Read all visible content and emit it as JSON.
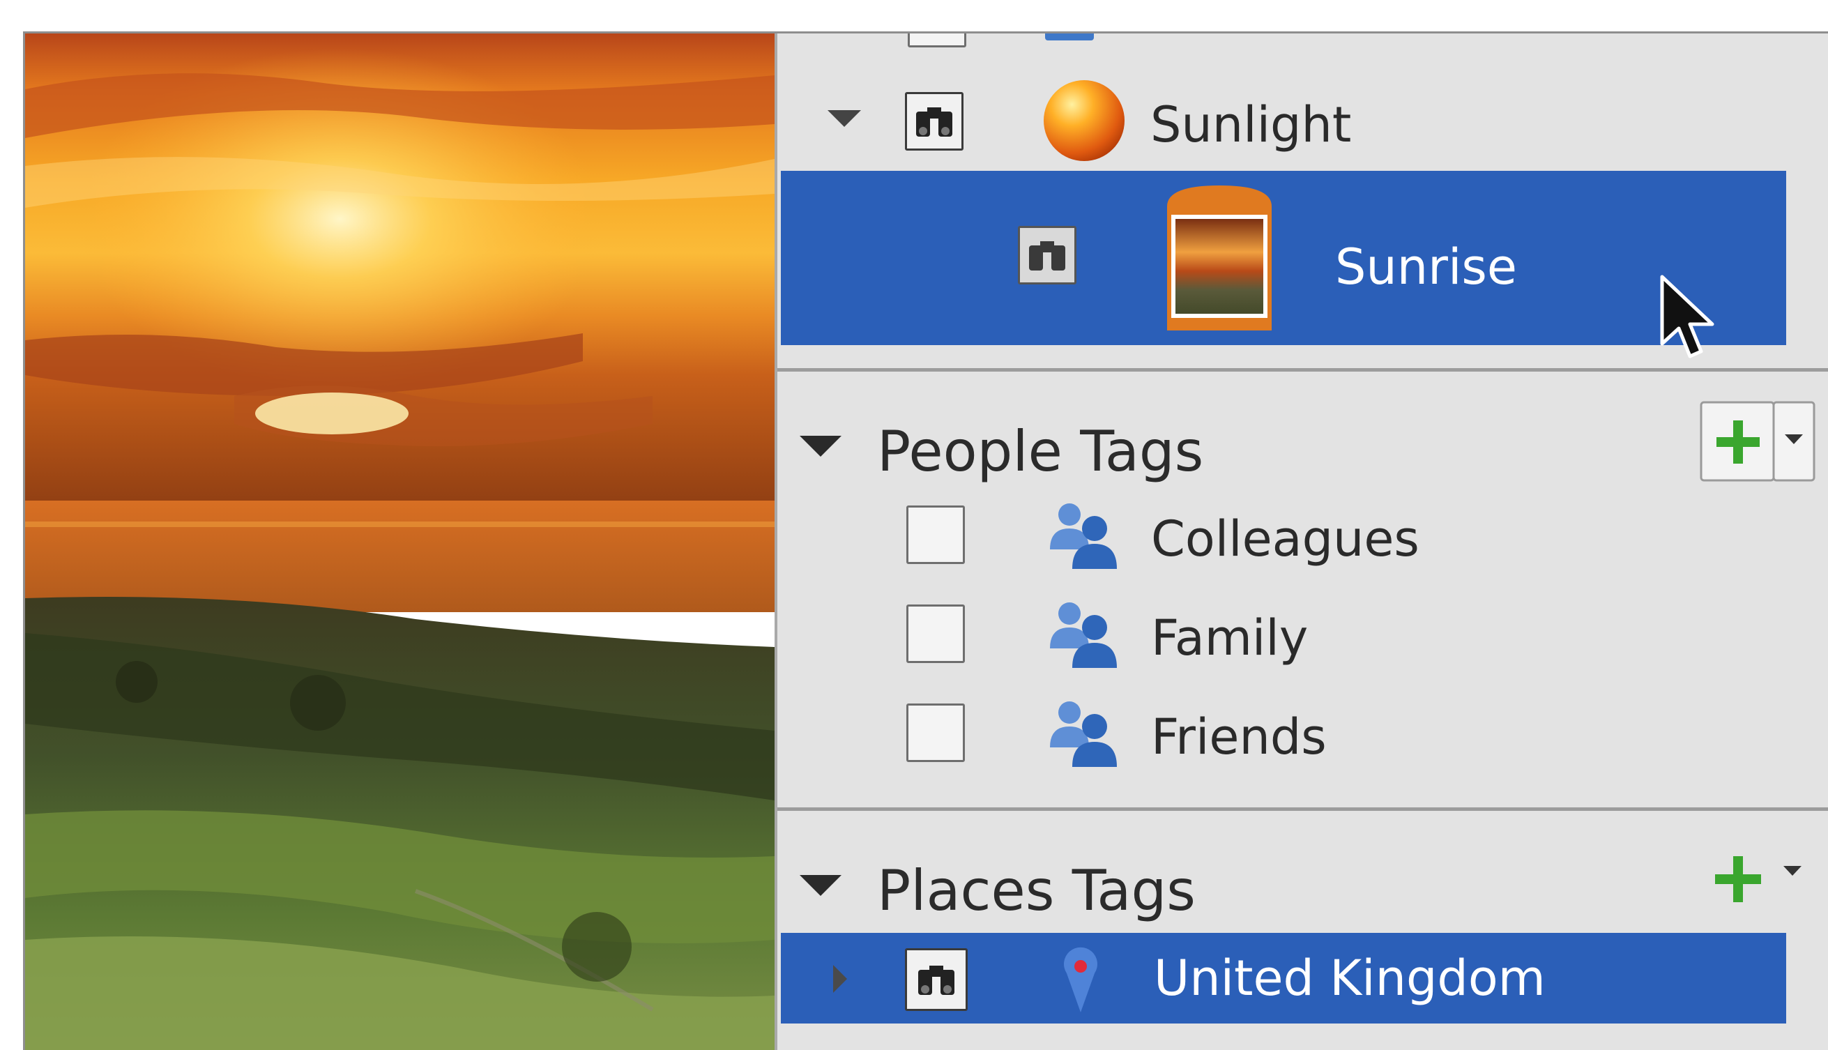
{
  "keyword_tags": {
    "items": [
      {
        "label": "Sunlight",
        "icon": "sun-orb-icon"
      },
      {
        "label": "Sunrise",
        "icon": "photo-thumbnail-icon",
        "selected": true
      }
    ]
  },
  "people_tags": {
    "title": "People Tags",
    "items": [
      {
        "label": "Colleagues",
        "icon": "people-icon"
      },
      {
        "label": "Family",
        "icon": "people-icon"
      },
      {
        "label": "Friends",
        "icon": "people-icon"
      }
    ]
  },
  "places_tags": {
    "title": "Places Tags",
    "items": [
      {
        "label": "United Kingdom",
        "icon": "map-pin-icon",
        "selected": true
      }
    ]
  },
  "colors": {
    "selection": "#2b5fb8",
    "panel_bg": "#e3e3e3",
    "add_green": "#3aa62e"
  }
}
